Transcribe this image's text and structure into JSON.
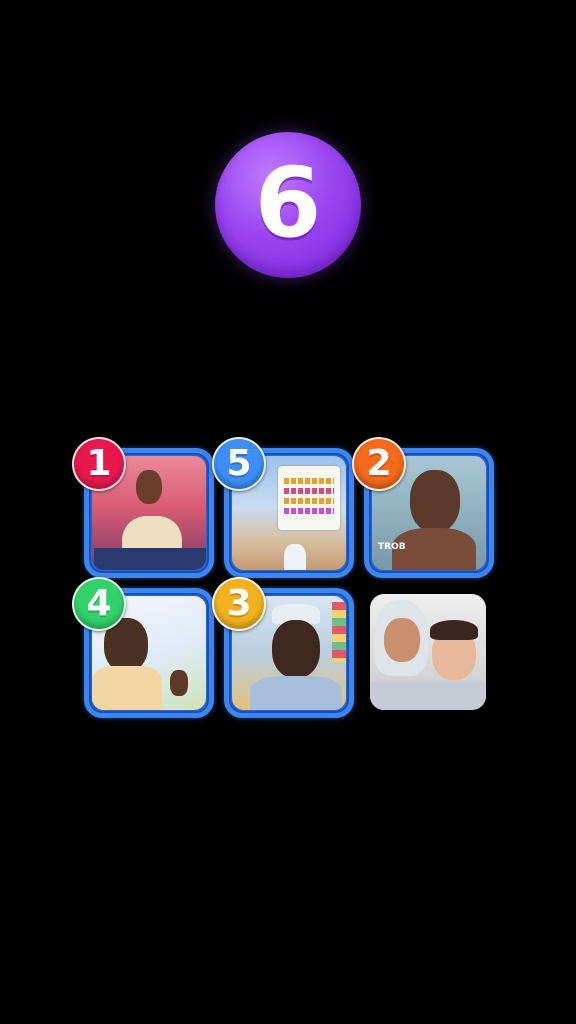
{
  "countdown": {
    "value": "6",
    "color": "#9a45f0"
  },
  "grid": {
    "tiles": [
      {
        "rank": "1",
        "rank_color": "#e8194f",
        "scene": "scene-red",
        "framed": true
      },
      {
        "rank": "5",
        "rank_color": "#3d8ef5",
        "scene": "scene-sky",
        "framed": true
      },
      {
        "rank": "2",
        "rank_color": "#f56a1b",
        "scene": "scene-store",
        "framed": true
      },
      {
        "rank": "4",
        "rank_color": "#34d26a",
        "scene": "scene-bright",
        "framed": true
      },
      {
        "rank": "3",
        "rank_color": "#f2b21f",
        "scene": "scene-shop",
        "framed": true
      },
      {
        "rank": "",
        "rank_color": "",
        "scene": "scene-white",
        "framed": false
      }
    ],
    "frame_color": "#3c86f2"
  },
  "tile_overlay_text": {
    "tile2": "TROB"
  }
}
